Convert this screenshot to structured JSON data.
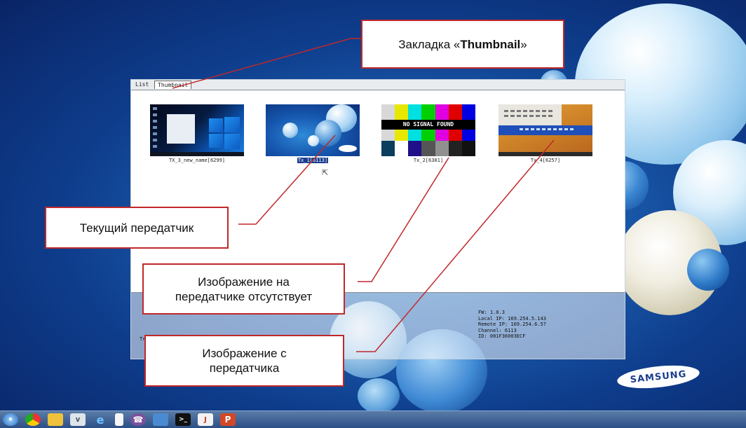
{
  "window": {
    "tabs": [
      {
        "label": "List",
        "active": false
      },
      {
        "label": "Thumbnail",
        "active": true
      }
    ]
  },
  "thumbnails": [
    {
      "label": "TX_3_new_name[6299]",
      "selected": false,
      "image": "windows-10-desktop"
    },
    {
      "label": "Tx_1[6113]",
      "selected": true,
      "image": "blue-bubbles-desktop"
    },
    {
      "label": "Tx_2[6301]",
      "selected": false,
      "image": "no-signal-color-bars",
      "overlay_text": "NO SIGNAL FOUND"
    },
    {
      "label": "Tx_4[6257]",
      "selected": false,
      "image": "windows-8-desktop"
    }
  ],
  "status": {
    "left_text": "Tr",
    "info": {
      "fw": "FW: 1.0.3",
      "local_ip": "Local IP: 169.254.5.143",
      "remote_ip": "Remote IP: 169.254.6.57",
      "channel": "Channel: 6113",
      "id": "ID: 001F36003ECF"
    }
  },
  "callouts": {
    "thumbnail_tab": {
      "prefix": "Закладка «",
      "bold": "Thumbnail",
      "suffix": "»"
    },
    "current_tx": "Текущий передатчик",
    "no_image_line1": "Изображение на",
    "no_image_line2": "передатчике отсутствует",
    "tx_image_line1": "Изображение с",
    "tx_image_line2": "передатчика"
  },
  "desktop": {
    "logo": "SAMSUNG"
  },
  "taskbar": {
    "icons": [
      "start-orb-icon",
      "chrome-icon",
      "file-explorer-icon",
      "vnc-viewer-icon",
      "internet-explorer-icon",
      "notepad-icon",
      "viber-icon",
      "network-icon",
      "command-prompt-icon",
      "java-icon",
      "powerpoint-icon"
    ]
  },
  "colors": {
    "callout_border": "#c0282a",
    "selection": "#1c3d8f",
    "taskbar": "#2c4f86"
  }
}
